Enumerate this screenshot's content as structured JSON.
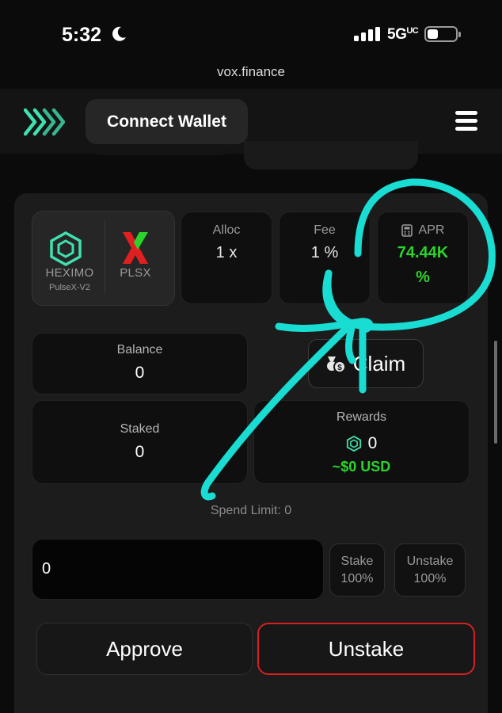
{
  "status_bar": {
    "time": "5:32",
    "network": "5G",
    "network_sup": "UC"
  },
  "browser": {
    "url": "vox.finance"
  },
  "nav": {
    "connect_label": "Connect Wallet"
  },
  "pair": {
    "token1": "HEXIMO",
    "token1_sub": "PulseX-V2",
    "token2": "PLSX"
  },
  "stats": {
    "alloc_label": "Alloc",
    "alloc_value": "1 x",
    "fee_label": "Fee",
    "fee_value": "1 %",
    "apr_label": "APR",
    "apr_value_line1": "74.44K",
    "apr_value_line2": "%"
  },
  "balance": {
    "label": "Balance",
    "value": "0"
  },
  "claim": {
    "label": "Claim"
  },
  "staked": {
    "label": "Staked",
    "value": "0"
  },
  "rewards": {
    "label": "Rewards",
    "value": "0",
    "usd": "~$0 USD"
  },
  "spend_limit": "Spend Limit: 0",
  "amount_input": {
    "value": "0"
  },
  "quick": {
    "stake_line1": "Stake",
    "stake_line2": "100%",
    "unstake_line1": "Unstake",
    "unstake_line2": "100%"
  },
  "actions": {
    "approve": "Approve",
    "unstake": "Unstake"
  },
  "colors": {
    "accent_green": "#2bd42b",
    "logo_teal": "#3fe0b0",
    "danger_red": "#d62020",
    "annotation_cyan": "#19dcd2"
  }
}
